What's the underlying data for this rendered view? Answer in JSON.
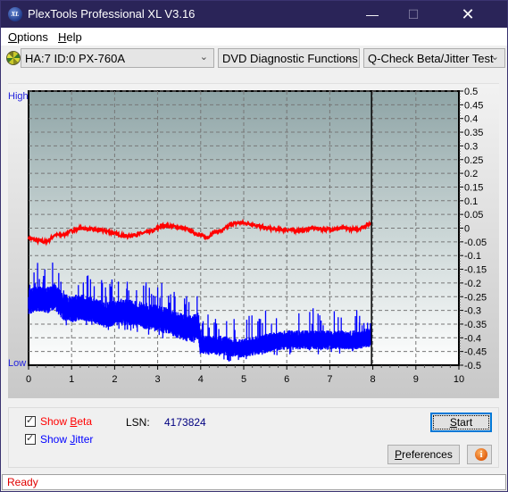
{
  "window": {
    "title": "PlexTools Professional XL V3.16",
    "app_icon_text": "XL",
    "minimize_glyph": "—",
    "maximize_glyph": "☐",
    "close_glyph": "✕"
  },
  "menu": {
    "items": [
      {
        "label_prefix": "",
        "mnemonic": "O",
        "label_rest": "ptions"
      },
      {
        "label_prefix": "",
        "mnemonic": "H",
        "label_rest": "elp"
      }
    ]
  },
  "toolbar": {
    "drive_select": "HA:7 ID:0  PX-760A",
    "function_select": "DVD Diagnostic Functions",
    "test_select": "Q-Check Beta/Jitter Test",
    "chevron_glyph": "⌄"
  },
  "chart_labels": {
    "high": "High",
    "low": "Low"
  },
  "controls": {
    "show_beta": {
      "prefix": "Show ",
      "mnemonic": "B",
      "rest": "eta",
      "checked": true,
      "color": "#ff0000"
    },
    "show_jitter": {
      "prefix": "Show ",
      "mnemonic": "J",
      "rest": "itter",
      "checked": true,
      "color": "#0000ff"
    },
    "lsn_label": "LSN:",
    "lsn_value": "4173824",
    "start_button": {
      "mnemonic": "S",
      "rest": "tart"
    },
    "preferences_button": {
      "mnemonic": "P",
      "rest": "references"
    },
    "info_glyph": "i"
  },
  "status": {
    "text": "Ready"
  },
  "chart_data": {
    "type": "line",
    "title": "",
    "xlabel": "",
    "ylabel": "",
    "xlim": [
      0,
      10
    ],
    "ylim": [
      -0.5,
      0.5
    ],
    "x_ticks": [
      0,
      1,
      2,
      3,
      4,
      5,
      6,
      7,
      8,
      9,
      10
    ],
    "y_ticks": [
      "0.5",
      "0.45",
      "0.4",
      "0.35",
      "0.3",
      "0.25",
      "0.2",
      "0.15",
      "0.1",
      "0.05",
      "0",
      "-0.05",
      "-0.1",
      "-0.15",
      "-0.2",
      "-0.25",
      "-0.3",
      "-0.35",
      "-0.4",
      "-0.45",
      "-0.5"
    ],
    "grid": true,
    "end_marker_x": 7.97,
    "colors": {
      "beta": "#ff0000",
      "jitter": "#0000ff"
    },
    "series": [
      {
        "name": "Beta",
        "x": [
          0,
          0.2,
          0.4,
          0.5,
          0.6,
          0.8,
          1.0,
          1.2,
          1.5,
          1.8,
          2.0,
          2.3,
          2.6,
          2.9,
          3.1,
          3.4,
          3.7,
          3.9,
          4.05,
          4.15,
          4.3,
          4.5,
          4.7,
          4.9,
          5.2,
          5.5,
          5.8,
          6.0,
          6.3,
          6.6,
          7.0,
          7.3,
          7.6,
          7.8,
          7.97
        ],
        "values": [
          -0.035,
          -0.045,
          -0.05,
          -0.04,
          -0.025,
          -0.025,
          -0.01,
          0.0,
          -0.005,
          -0.01,
          -0.02,
          -0.03,
          -0.02,
          -0.01,
          0.01,
          0.005,
          -0.005,
          -0.02,
          -0.03,
          -0.035,
          -0.015,
          -0.01,
          0.015,
          0.02,
          0.015,
          0.0,
          -0.005,
          -0.005,
          -0.01,
          0.0,
          -0.005,
          0.0,
          -0.005,
          0.005,
          0.02
        ]
      },
      {
        "name": "Jitter",
        "x": [
          0,
          0.2,
          0.4,
          0.6,
          0.8,
          1.0,
          1.2,
          1.5,
          1.8,
          2.0,
          2.3,
          2.6,
          2.9,
          3.2,
          3.5,
          3.8,
          3.95,
          4.0,
          4.2,
          4.5,
          4.8,
          5.0,
          5.3,
          5.6,
          6.0,
          6.4,
          6.8,
          7.2,
          7.6,
          7.97
        ],
        "values": [
          -0.27,
          -0.26,
          -0.27,
          -0.25,
          -0.29,
          -0.3,
          -0.29,
          -0.3,
          -0.32,
          -0.31,
          -0.31,
          -0.32,
          -0.33,
          -0.34,
          -0.36,
          -0.37,
          -0.36,
          -0.43,
          -0.43,
          -0.43,
          -0.44,
          -0.44,
          -0.43,
          -0.42,
          -0.41,
          -0.41,
          -0.41,
          -0.41,
          -0.41,
          -0.4
        ]
      }
    ]
  }
}
